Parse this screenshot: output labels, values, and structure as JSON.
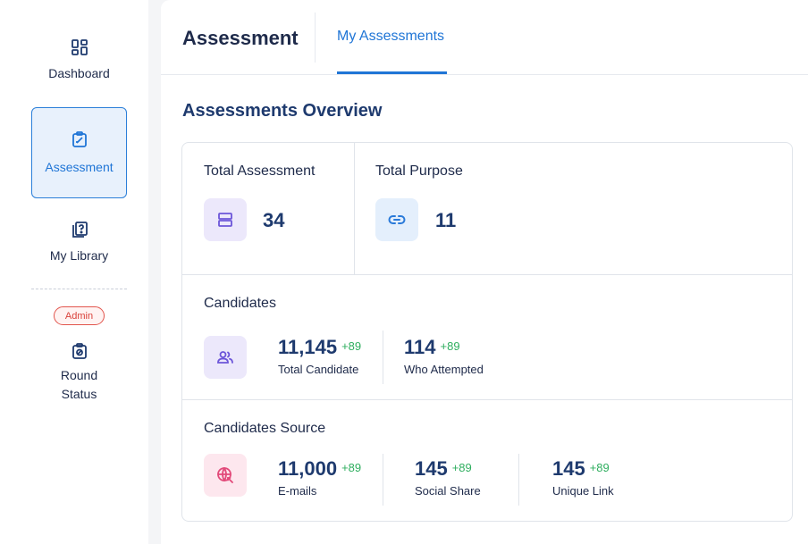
{
  "sidebar": {
    "items": [
      {
        "label": "Dashboard"
      },
      {
        "label": "Assessment"
      },
      {
        "label": "My Library"
      }
    ],
    "admin_badge": "Admin",
    "round_status": {
      "line1": "Round",
      "line2": "Status"
    }
  },
  "header": {
    "title": "Assessment",
    "tabs": [
      {
        "label": "My Assessments",
        "active": true
      }
    ]
  },
  "overview": {
    "title": "Assessments Overview",
    "total_assessment": {
      "label": "Total Assessment",
      "value": "34"
    },
    "total_purpose": {
      "label": "Total Purpose",
      "value": "11"
    },
    "candidates": {
      "label": "Candidates",
      "stats": [
        {
          "value": "11,145",
          "delta": "+89",
          "caption": "Total Candidate"
        },
        {
          "value": "114",
          "delta": "+89",
          "caption": "Who Attempted"
        }
      ]
    },
    "candidates_source": {
      "label": "Candidates Source",
      "stats": [
        {
          "value": "11,000",
          "delta": "+89",
          "caption": "E-mails"
        },
        {
          "value": "145",
          "delta": "+89",
          "caption": "Social Share"
        },
        {
          "value": "145",
          "delta": "+89",
          "caption": "Unique Link"
        }
      ]
    }
  },
  "colors": {
    "accent": "#1f75d6",
    "positive": "#2fae5f",
    "admin": "#d9413a"
  },
  "icons": [
    "dashboard-icon",
    "assessment-icon",
    "library-icon",
    "round-status-icon",
    "stack-icon",
    "link-icon",
    "users-icon",
    "globe-icon"
  ]
}
